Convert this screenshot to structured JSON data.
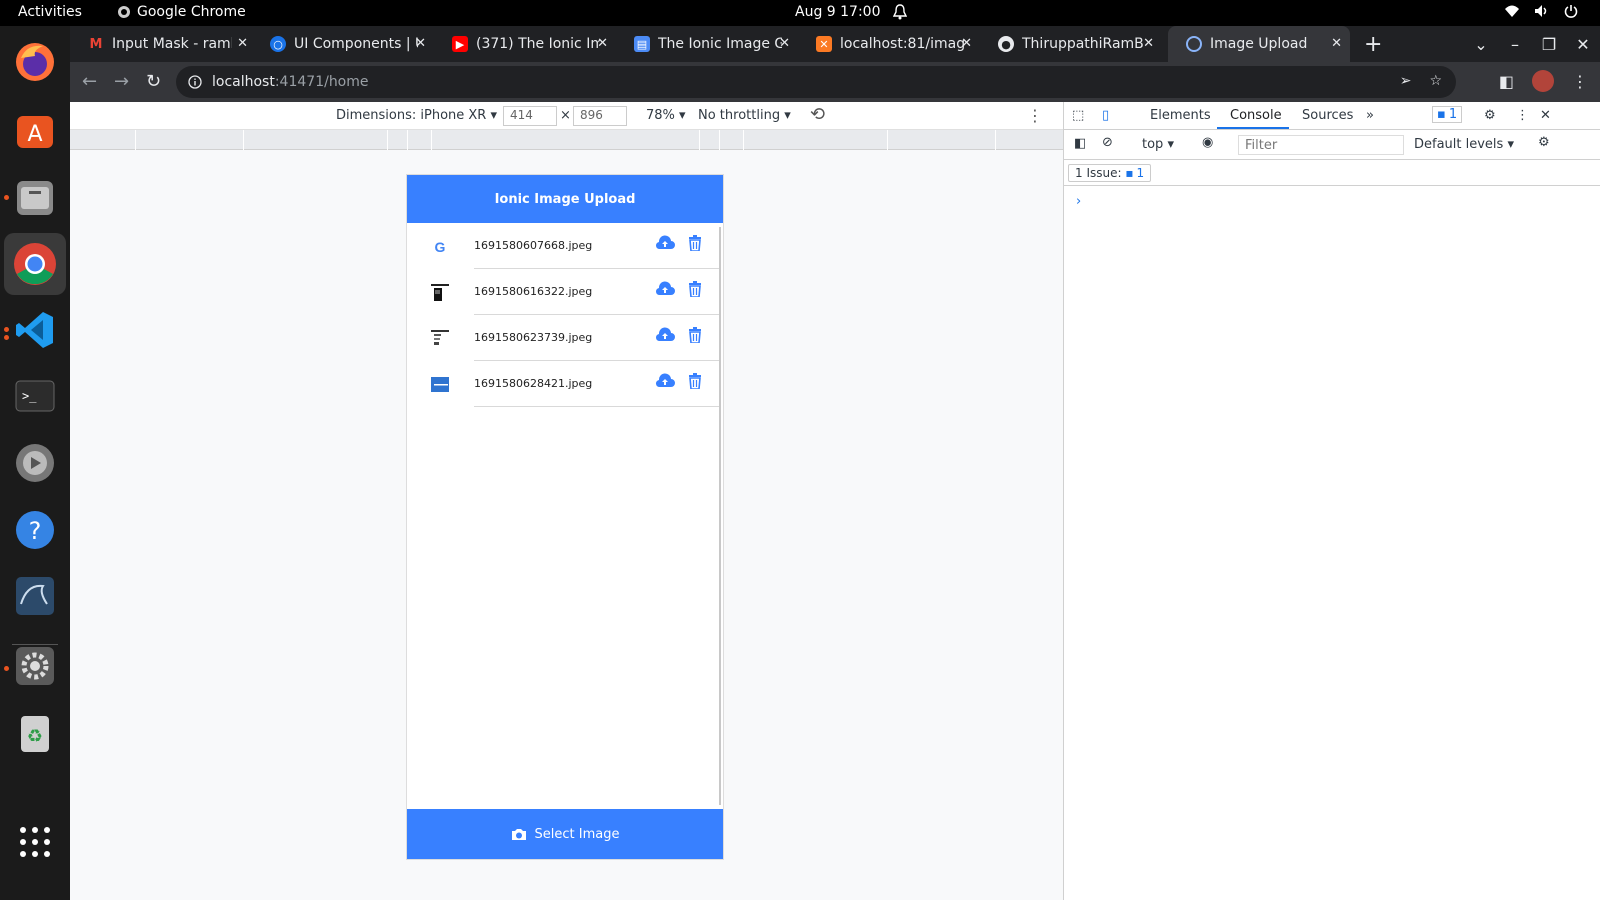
{
  "system": {
    "activities": "Activities",
    "app_name": "Google Chrome",
    "clock": "Aug 9  17:00"
  },
  "tabs": [
    {
      "title": "Input Mask - ramb",
      "icon": "gmail-icon"
    },
    {
      "title": "UI Components | U",
      "icon": "globe-icon"
    },
    {
      "title": "(371) The Ionic Ima",
      "icon": "youtube-icon"
    },
    {
      "title": "The Ionic Image G",
      "icon": "doc-icon"
    },
    {
      "title": "localhost:81/imag",
      "icon": "xampp-icon"
    },
    {
      "title": "ThiruppathiRamB",
      "icon": "github-icon"
    },
    {
      "title": "Image Upload",
      "icon": "globe-icon",
      "active": true
    }
  ],
  "omnibox": {
    "host": "localhost",
    "path": ":41471/home"
  },
  "device_toolbar": {
    "dimensions": "Dimensions: iPhone XR",
    "width": "414",
    "height": "896",
    "times": "×",
    "zoom": "78%",
    "throttling": "No throttling"
  },
  "app": {
    "title": "Ionic Image Upload",
    "images": [
      {
        "name": "1691580607668.jpeg",
        "thumb": "google-logo"
      },
      {
        "name": "1691580616322.jpeg",
        "thumb": "dark-screenshot"
      },
      {
        "name": "1691580623739.jpeg",
        "thumb": "document-screenshot"
      },
      {
        "name": "1691580628421.jpeg",
        "thumb": "blue-banner"
      }
    ],
    "select_label": "Select Image"
  },
  "devtools": {
    "tabs": [
      "Elements",
      "Console",
      "Sources"
    ],
    "active_tab": "Console",
    "issue_count": "1",
    "context": "top",
    "filter_placeholder": "Filter",
    "levels": "Default levels",
    "issues_label": "1 Issue:",
    "issues_count": "1"
  },
  "colors": {
    "ionic_primary": "#3880ff",
    "devtools_accent": "#1a73e8"
  }
}
